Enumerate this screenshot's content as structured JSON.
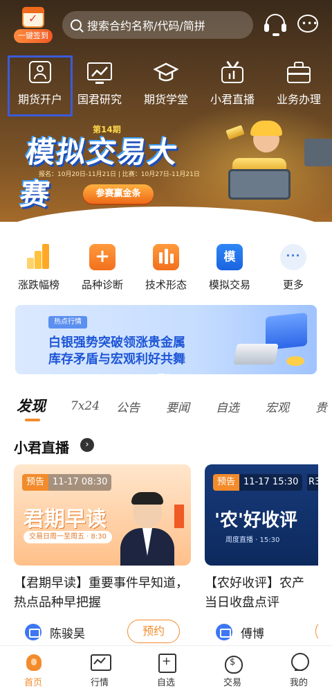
{
  "header": {
    "checkin_label": "一键签到",
    "search_placeholder": "搜索合约名称/代码/简拼"
  },
  "nav": [
    {
      "label": "期货开户",
      "icon": "user-card-icon"
    },
    {
      "label": "国君研究",
      "icon": "monitor-chart-icon"
    },
    {
      "label": "期货学堂",
      "icon": "graduation-cap-icon"
    },
    {
      "label": "小君直播",
      "icon": "tv-icon"
    },
    {
      "label": "业务办理",
      "icon": "briefcase-icon"
    }
  ],
  "hero_banner": {
    "period_label": "第14期",
    "title": "模拟交易大赛",
    "dates": "报名：10月20日-11月21日 | 比赛：10月27日-11月21日",
    "button": "参赛赢金条"
  },
  "tools": [
    {
      "label": "涨跌幅榜",
      "icon": "bar-rank-icon"
    },
    {
      "label": "品种诊断",
      "icon": "plus-box-icon"
    },
    {
      "label": "技术形态",
      "icon": "candlestick-icon"
    },
    {
      "label": "模拟交易",
      "icon": "simulate-icon",
      "glyph": "模"
    },
    {
      "label": "更多",
      "icon": "more-dots-icon",
      "glyph": "···"
    }
  ],
  "promo": {
    "tag": "热点行情",
    "line1": "白银强势突破领涨贵金属",
    "line2": "库存矛盾与宏观利好共舞"
  },
  "tabs": [
    "发现",
    "7x24",
    "公告",
    "要闻",
    "自选",
    "宏观",
    "贵"
  ],
  "live": {
    "section_title": "小君直播",
    "cards": [
      {
        "badge": "预告",
        "time": "11-17 08:30",
        "show_title": "君期早读",
        "schedule": "交易日周一至周五 · 8:30",
        "title": "【君期早读】重要事件早知道，热点品种早把握",
        "host": "陈骏昊",
        "action": "预约"
      },
      {
        "badge": "预告",
        "time": "11-17 15:30",
        "time_extra": "R3",
        "show_title": "'农'好收评",
        "schedule": "周度直播 · 15:30",
        "title_line1": "【农好收评】农产",
        "title_line2": "当日收盘点评",
        "host": "傅博"
      }
    ]
  },
  "tabbar": [
    {
      "label": "首页",
      "active": true
    },
    {
      "label": "行情"
    },
    {
      "label": "自选"
    },
    {
      "label": "交易"
    },
    {
      "label": "我的"
    }
  ],
  "colors": {
    "accent": "#f28b2b",
    "brand_blue": "#1e56d6",
    "selection_outline": "#3b5bdb"
  }
}
